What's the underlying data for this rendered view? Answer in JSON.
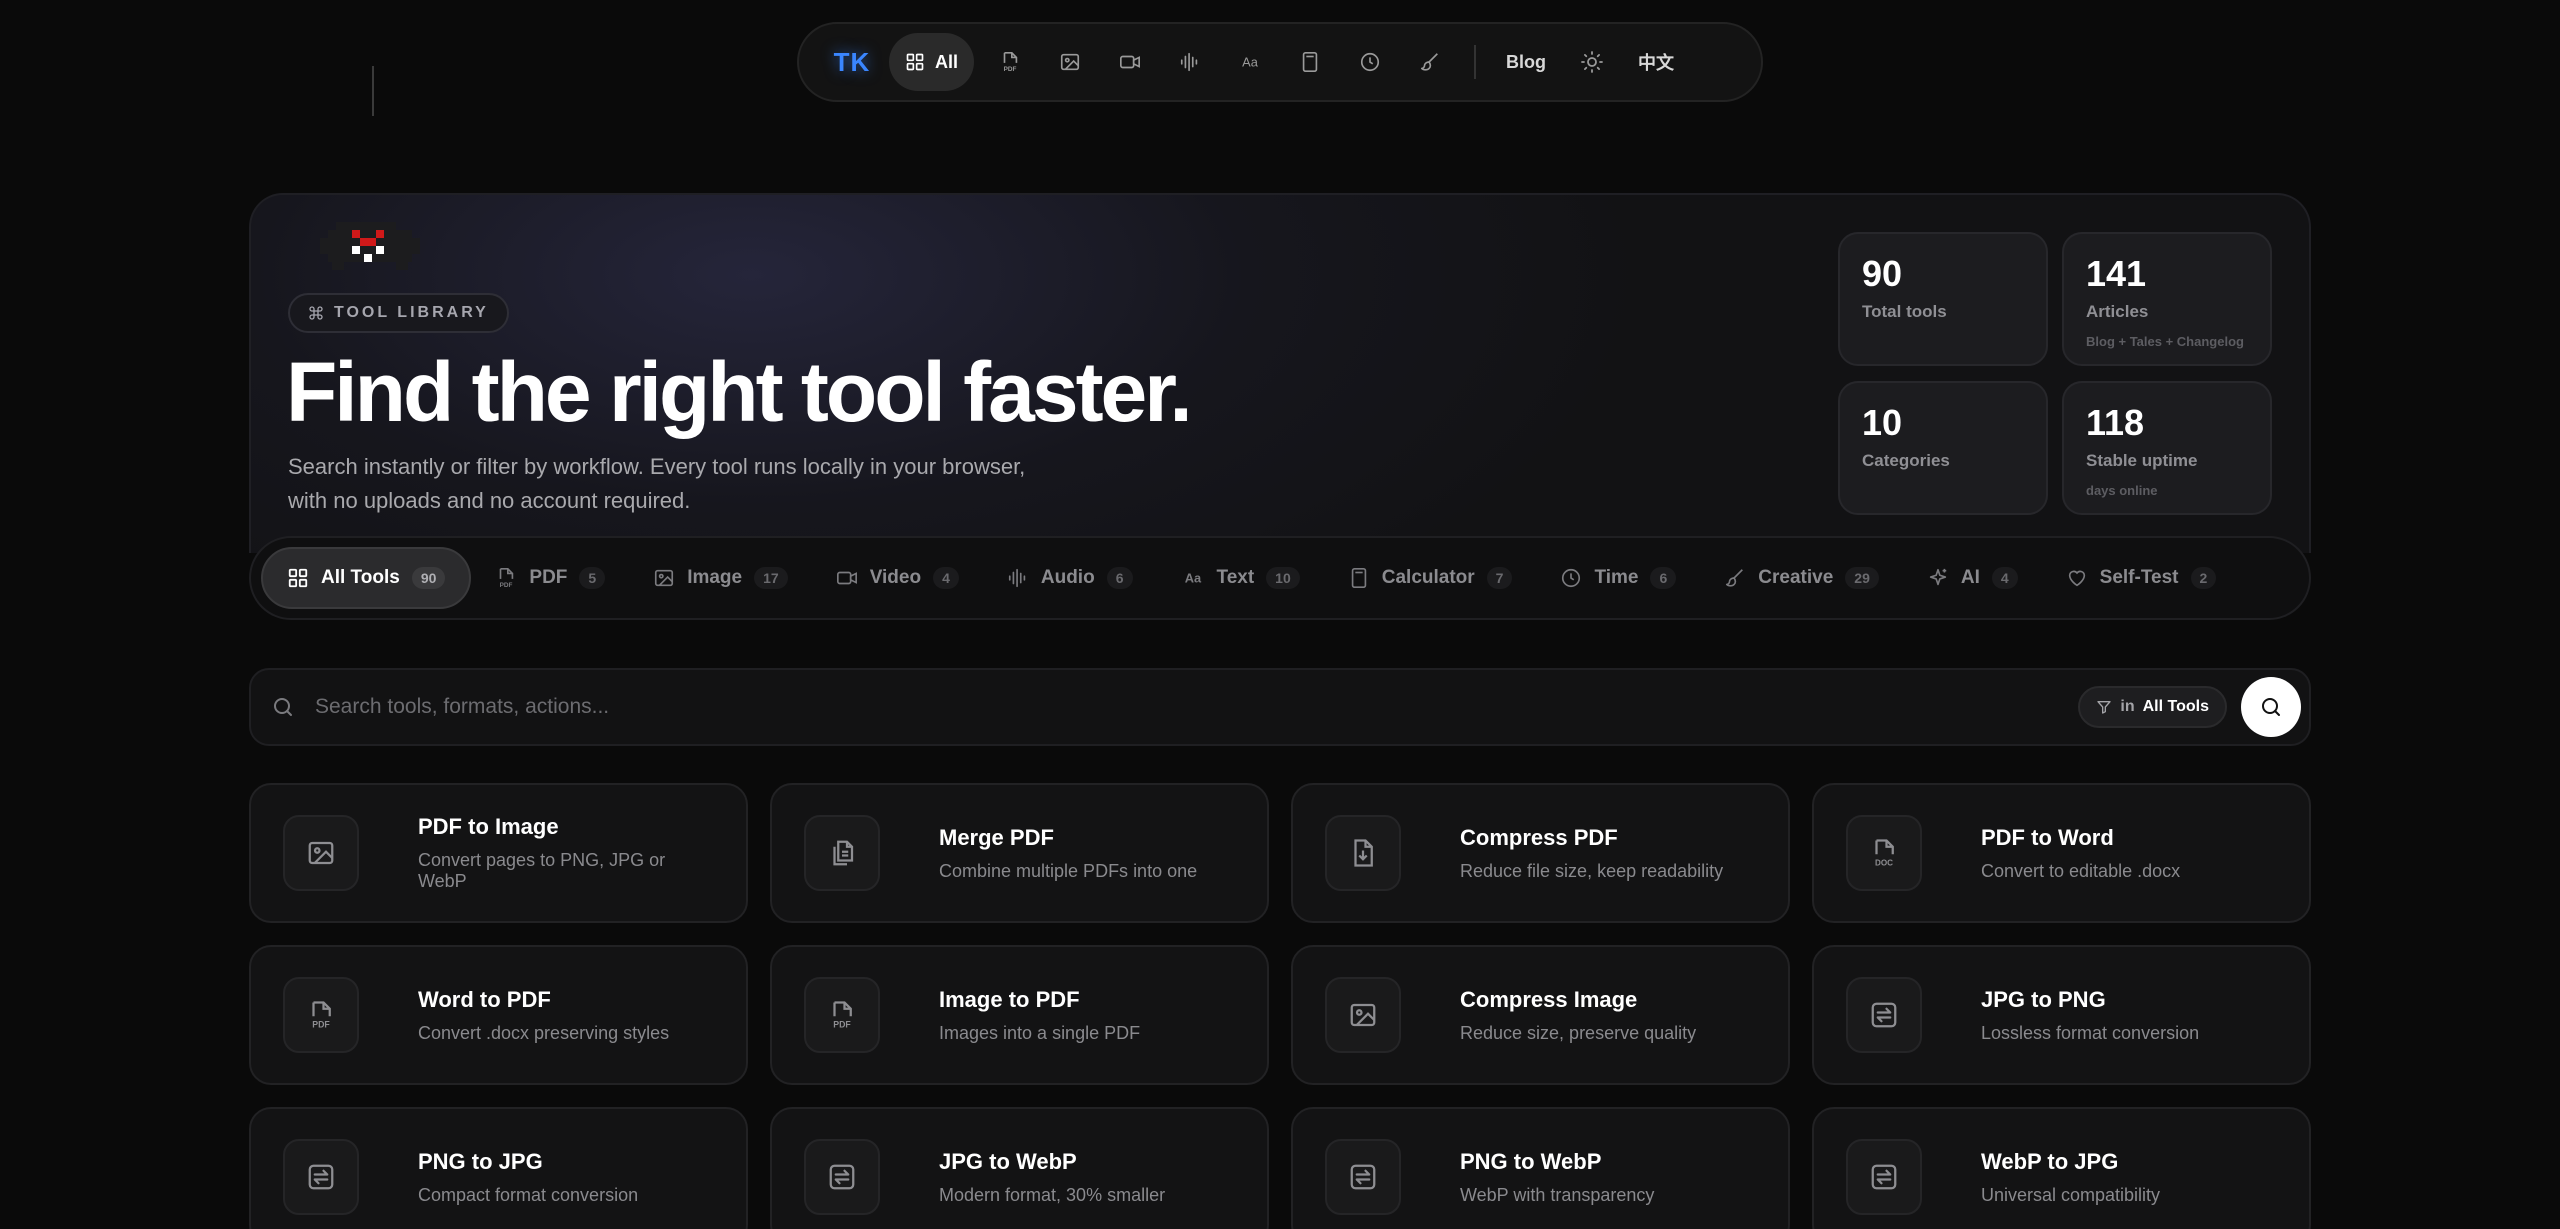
{
  "nav": {
    "logo": "TK",
    "all_label": "All",
    "icons": [
      "pdf-icon",
      "image-icon",
      "video-icon",
      "audio-icon",
      "text-icon",
      "calculator-icon",
      "clock-icon",
      "brush-icon"
    ],
    "blog_label": "Blog",
    "lang_label": "中文"
  },
  "hero": {
    "tag": "TOOL LIBRARY",
    "title": "Find the right tool faster.",
    "subtitle_line1": "Search instantly or filter by workflow. Every tool runs locally in your browser,",
    "subtitle_line2": "with no uploads and no account required."
  },
  "stats": [
    {
      "value": "90",
      "label": "Total tools",
      "note": ""
    },
    {
      "value": "141",
      "label": "Articles",
      "note": "Blog + Tales + Changelog"
    },
    {
      "value": "10",
      "label": "Categories",
      "note": ""
    },
    {
      "value": "118",
      "label": "Stable uptime",
      "note": "days online"
    }
  ],
  "categories": [
    {
      "label": "All Tools",
      "count": "90",
      "icon": "grid-icon",
      "active": true
    },
    {
      "label": "PDF",
      "count": "5",
      "icon": "pdf-icon"
    },
    {
      "label": "Image",
      "count": "17",
      "icon": "image-icon"
    },
    {
      "label": "Video",
      "count": "4",
      "icon": "video-icon"
    },
    {
      "label": "Audio",
      "count": "6",
      "icon": "audio-icon"
    },
    {
      "label": "Text",
      "count": "10",
      "icon": "text-icon"
    },
    {
      "label": "Calculator",
      "count": "7",
      "icon": "calculator-icon"
    },
    {
      "label": "Time",
      "count": "6",
      "icon": "clock-icon"
    },
    {
      "label": "Creative",
      "count": "29",
      "icon": "brush-icon"
    },
    {
      "label": "AI",
      "count": "4",
      "icon": "sparkle-icon"
    },
    {
      "label": "Self-Test",
      "count": "2",
      "icon": "heart-icon"
    }
  ],
  "search": {
    "placeholder": "Search tools, formats, actions...",
    "scope_prefix": "in",
    "scope_value": "All Tools"
  },
  "tools": [
    {
      "title": "PDF to Image",
      "desc": "Convert pages to PNG, JPG or WebP",
      "icon": "image-icon"
    },
    {
      "title": "Merge PDF",
      "desc": "Combine multiple PDFs into one",
      "icon": "files-icon"
    },
    {
      "title": "Compress PDF",
      "desc": "Reduce file size, keep readability",
      "icon": "file-download-icon"
    },
    {
      "title": "PDF to Word",
      "desc": "Convert to editable .docx",
      "icon": "doc-icon"
    },
    {
      "title": "Word to PDF",
      "desc": "Convert .docx preserving styles",
      "icon": "pdf-icon"
    },
    {
      "title": "Image to PDF",
      "desc": "Images into a single PDF",
      "icon": "pdf-icon"
    },
    {
      "title": "Compress Image",
      "desc": "Reduce size, preserve quality",
      "icon": "image-icon"
    },
    {
      "title": "JPG to PNG",
      "desc": "Lossless format conversion",
      "icon": "convert-icon"
    },
    {
      "title": "PNG to JPG",
      "desc": "Compact format conversion",
      "icon": "convert-icon"
    },
    {
      "title": "JPG to WebP",
      "desc": "Modern format, 30% smaller",
      "icon": "convert-icon"
    },
    {
      "title": "PNG to WebP",
      "desc": "WebP with transparency",
      "icon": "convert-icon"
    },
    {
      "title": "WebP to JPG",
      "desc": "Universal compatibility",
      "icon": "convert-icon"
    }
  ]
}
